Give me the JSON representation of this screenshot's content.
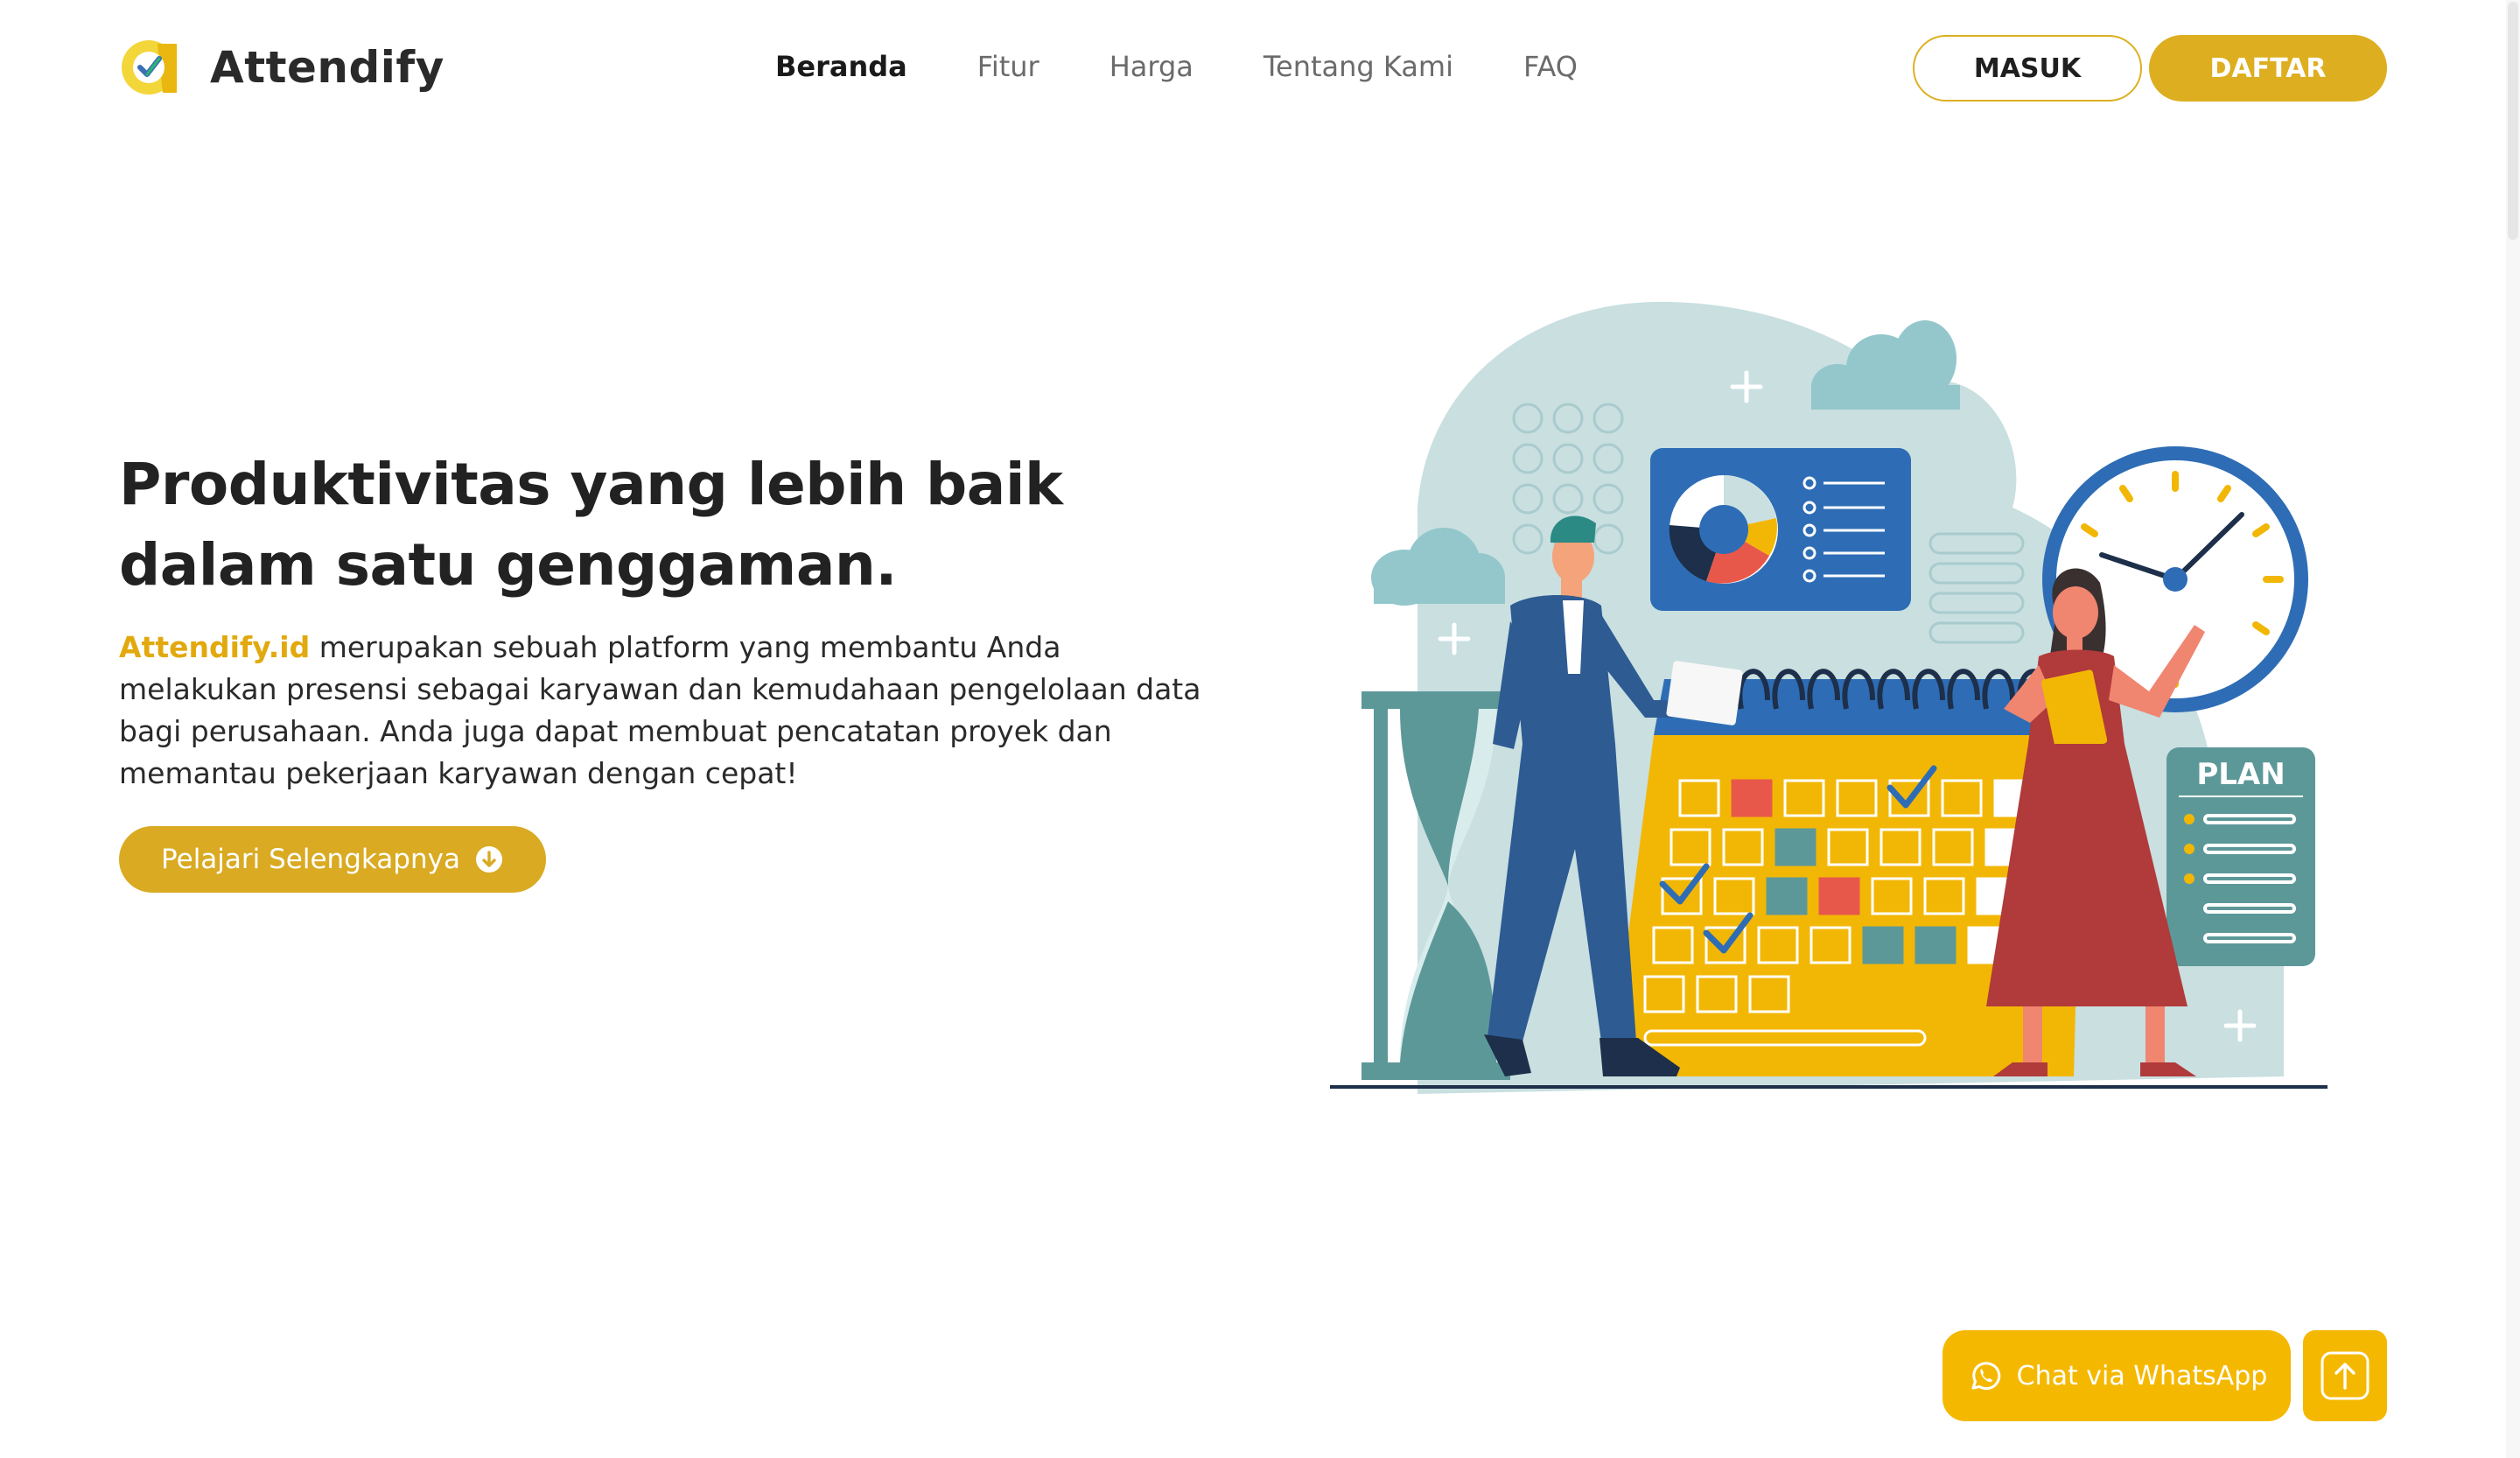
{
  "brand": {
    "name": "Attendify"
  },
  "nav": {
    "items": [
      {
        "label": "Beranda",
        "active": true
      },
      {
        "label": "Fitur",
        "active": false
      },
      {
        "label": "Harga",
        "active": false
      },
      {
        "label": "Tentang Kami",
        "active": false
      },
      {
        "label": "FAQ",
        "active": false
      }
    ]
  },
  "auth": {
    "login_label": "MASUK",
    "register_label": "DAFTAR"
  },
  "hero": {
    "title_line1": "Produktivitas yang lebih baik",
    "title_line2": "dalam satu genggaman.",
    "brand_link": "Attendify.id",
    "description": " merupakan sebuah platform yang membantu Anda melakukan presensi sebagai karyawan dan kemudahaan pengelolaan data bagi perusahaan. Anda juga dapat membuat pencatatan proyek dan memantau pekerjaan karyawan dengan cepat!",
    "cta_label": "Pelajari Selengkapnya"
  },
  "illustration": {
    "plan_label": "PLAN"
  },
  "floating": {
    "whatsapp_label": "Chat via WhatsApp"
  },
  "colors": {
    "accent": "#ddae1f",
    "brand_text": "#e2a90e",
    "whatsapp_button": "#f5b800",
    "calendar": "#f2b705",
    "blue": "#2f5d95",
    "red": "#b13a3a",
    "teal_light": "#c9dfe0"
  }
}
